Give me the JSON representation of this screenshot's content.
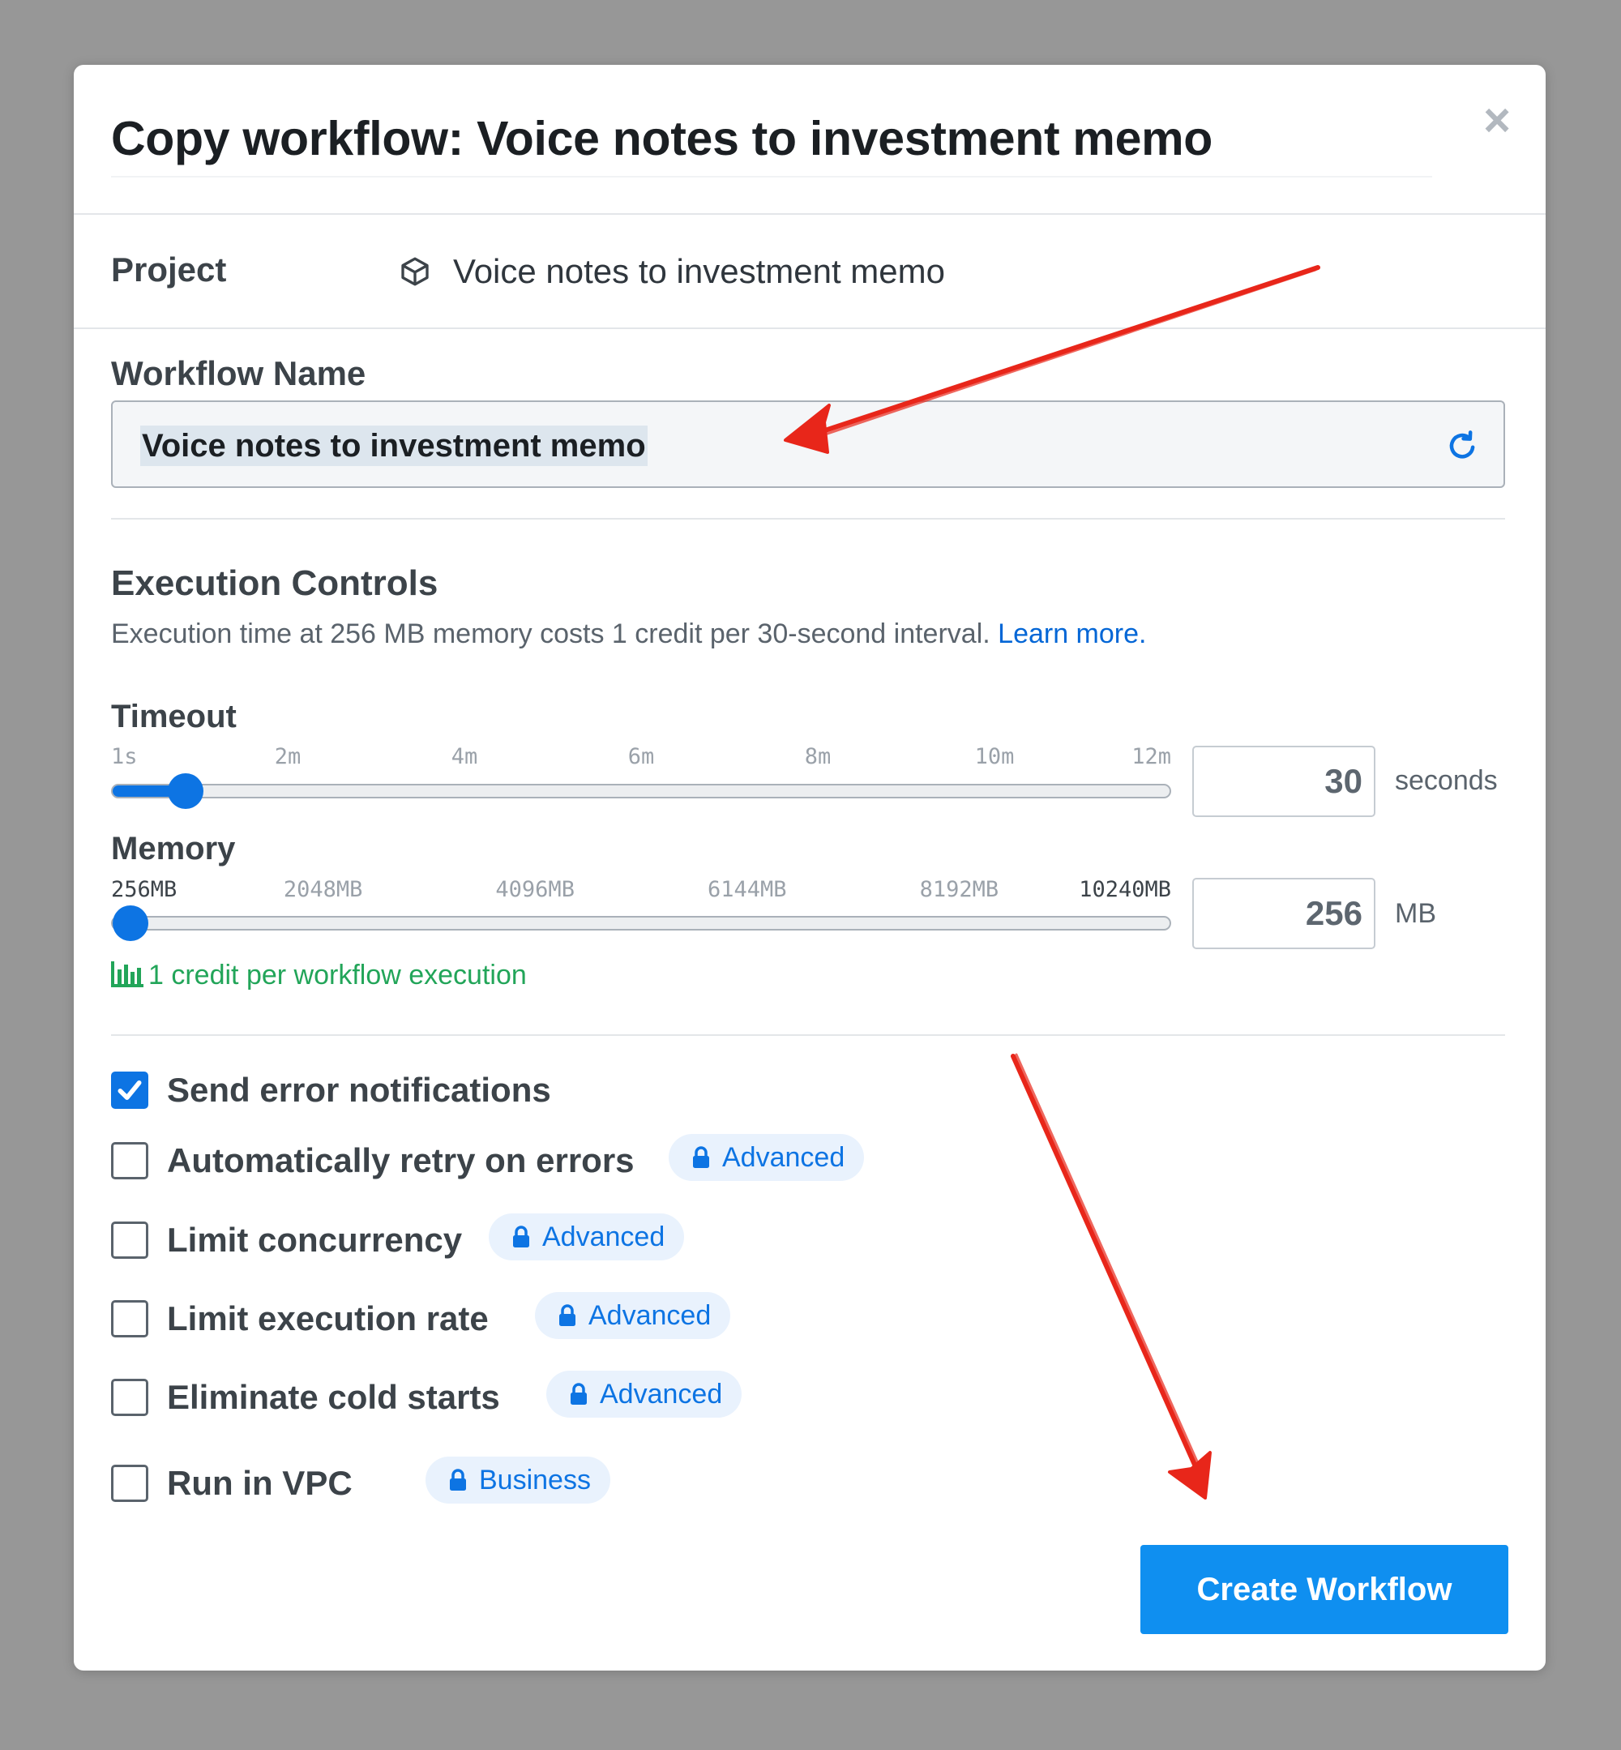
{
  "modal": {
    "title": "Copy workflow: Voice notes to investment memo",
    "close_icon": "close-icon"
  },
  "project": {
    "label": "Project",
    "icon": "cube-icon",
    "value": "Voice notes to investment memo"
  },
  "workflow_name": {
    "label": "Workflow Name",
    "value": "Voice notes to investment memo",
    "icon": "refresh-icon"
  },
  "execution": {
    "title": "Execution Controls",
    "description": "Execution time at 256 MB memory costs 1 credit per 30-second interval.",
    "learn_more": "Learn more."
  },
  "timeout": {
    "label": "Timeout",
    "ticks": [
      "1s",
      "2m",
      "4m",
      "6m",
      "8m",
      "10m",
      "12m"
    ],
    "value": "30",
    "unit": "seconds",
    "slider_fraction": 0.054
  },
  "memory": {
    "label": "Memory",
    "ticks": [
      "256MB",
      "2048MB",
      "4096MB",
      "6144MB",
      "8192MB",
      "10240MB"
    ],
    "value": "256",
    "unit": "MB",
    "slider_fraction": 0.0
  },
  "credit_note": {
    "icon": "bar-chart-icon",
    "text": "1 credit per workflow execution"
  },
  "options": [
    {
      "label": "Send error notifications",
      "checked": true
    },
    {
      "label": "Automatically retry on errors",
      "checked": false,
      "badge": "Advanced"
    },
    {
      "label": "Limit concurrency",
      "checked": false,
      "badge": "Advanced"
    },
    {
      "label": "Limit execution rate",
      "checked": false,
      "badge": "Advanced"
    },
    {
      "label": "Eliminate cold starts",
      "checked": false,
      "badge": "Advanced"
    },
    {
      "label": "Run in VPC",
      "checked": false,
      "badge": "Business"
    }
  ],
  "actions": {
    "create": "Create Workflow"
  },
  "colors": {
    "accent": "#0d74e3",
    "button": "#0f8ff0",
    "success": "#22a559",
    "annotation": "#e8261a"
  }
}
